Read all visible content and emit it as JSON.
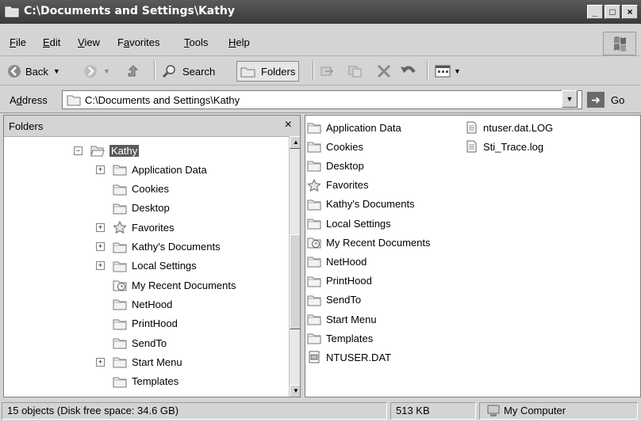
{
  "window": {
    "title": "C:\\Documents and Settings\\Kathy",
    "min_label": "_",
    "max_label": "□",
    "close_label": "×"
  },
  "menu": {
    "items": [
      {
        "accel": "F",
        "rest": "ile"
      },
      {
        "accel": "E",
        "rest": "dit"
      },
      {
        "accel": "V",
        "rest": "iew"
      },
      {
        "pre": "F",
        "accel": "a",
        "rest": "vorites"
      },
      {
        "accel": "T",
        "rest": "ools"
      },
      {
        "accel": "H",
        "rest": "elp"
      }
    ]
  },
  "toolbar": {
    "back_label": "Back",
    "search_label": "Search",
    "folders_label": "Folders"
  },
  "address": {
    "label_pre": "A",
    "label_accel": "d",
    "label_rest": "dress",
    "value": "C:\\Documents and Settings\\Kathy",
    "go_label": "Go"
  },
  "folders_pane": {
    "title": "Folders",
    "close": "×",
    "tree": [
      {
        "label": "Kathy",
        "expander": "−",
        "icon": "folder-open-icon",
        "selected": true
      },
      {
        "label": "Application Data",
        "expander": "+",
        "icon": "folder-icon"
      },
      {
        "label": "Cookies",
        "expander": "",
        "icon": "folder-icon"
      },
      {
        "label": "Desktop",
        "expander": "",
        "icon": "folder-icon"
      },
      {
        "label": "Favorites",
        "expander": "+",
        "icon": "star-icon"
      },
      {
        "label": "Kathy's Documents",
        "expander": "+",
        "icon": "folder-icon"
      },
      {
        "label": "Local Settings",
        "expander": "+",
        "icon": "folder-icon"
      },
      {
        "label": "My Recent Documents",
        "expander": "",
        "icon": "recent-docs-icon"
      },
      {
        "label": "NetHood",
        "expander": "",
        "icon": "folder-icon"
      },
      {
        "label": "PrintHood",
        "expander": "",
        "icon": "folder-icon"
      },
      {
        "label": "SendTo",
        "expander": "",
        "icon": "folder-icon"
      },
      {
        "label": "Start Menu",
        "expander": "+",
        "icon": "folder-icon"
      },
      {
        "label": "Templates",
        "expander": "",
        "icon": "folder-icon"
      }
    ]
  },
  "content": {
    "column1": [
      {
        "label": "Application Data",
        "icon": "folder-icon"
      },
      {
        "label": "Cookies",
        "icon": "folder-icon"
      },
      {
        "label": "Desktop",
        "icon": "folder-icon"
      },
      {
        "label": "Favorites",
        "icon": "star-icon"
      },
      {
        "label": "Kathy's Documents",
        "icon": "folder-icon"
      },
      {
        "label": "Local Settings",
        "icon": "folder-icon"
      },
      {
        "label": "My Recent Documents",
        "icon": "recent-docs-icon"
      },
      {
        "label": "NetHood",
        "icon": "folder-icon"
      },
      {
        "label": "PrintHood",
        "icon": "folder-icon"
      },
      {
        "label": "SendTo",
        "icon": "folder-icon"
      },
      {
        "label": "Start Menu",
        "icon": "folder-icon"
      },
      {
        "label": "Templates",
        "icon": "folder-icon"
      },
      {
        "label": "NTUSER.DAT",
        "icon": "system-file-icon"
      }
    ],
    "column2": [
      {
        "label": "ntuser.dat.LOG",
        "icon": "text-file-icon"
      },
      {
        "label": "Sti_Trace.log",
        "icon": "text-file-icon"
      }
    ]
  },
  "status": {
    "objects": "15 objects (Disk free space: 34.6 GB)",
    "size": "513 KB",
    "location": "My Computer"
  }
}
